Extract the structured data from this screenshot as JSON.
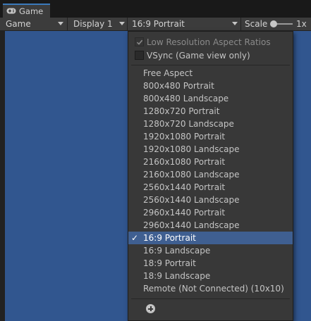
{
  "tab": {
    "title": "Game",
    "icon": "gamepad-icon",
    "accent": "#3a79bb"
  },
  "toolbar": {
    "view_mode": "Game",
    "display": "Display 1",
    "aspect": "16:9 Portrait",
    "scale_label": "Scale",
    "scale_value": "1x"
  },
  "viewport": {
    "background": "#31568f"
  },
  "dropdown": {
    "options": {
      "low_res": {
        "label": "Low Resolution Aspect Ratios",
        "checked": true,
        "enabled": false
      },
      "vsync": {
        "label": "VSync (Game view only)",
        "checked": false,
        "enabled": true
      }
    },
    "items": [
      {
        "label": "Free Aspect"
      },
      {
        "label": "800x480 Portrait"
      },
      {
        "label": "800x480 Landscape"
      },
      {
        "label": "1280x720 Portrait"
      },
      {
        "label": "1280x720 Landscape"
      },
      {
        "label": "1920x1080 Portrait"
      },
      {
        "label": "1920x1080 Landscape"
      },
      {
        "label": "2160x1080 Portrait"
      },
      {
        "label": "2160x1080 Landscape"
      },
      {
        "label": "2560x1440 Portrait"
      },
      {
        "label": "2560x1440 Landscape"
      },
      {
        "label": "2960x1440 Portrait"
      },
      {
        "label": "2960x1440 Landscape"
      },
      {
        "label": "16:9 Portrait"
      },
      {
        "label": "16:9 Landscape"
      },
      {
        "label": "18:9 Portrait"
      },
      {
        "label": "18:9 Landscape"
      },
      {
        "label": "Remote (Not Connected) (10x10)"
      }
    ],
    "selected_index": 13,
    "selected_mark": "✓",
    "add_icon": "plus-circle-icon"
  }
}
